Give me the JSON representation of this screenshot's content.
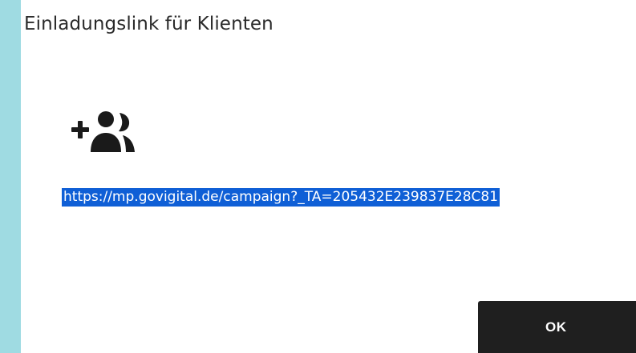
{
  "dialog": {
    "title": "Einladungslink für Klienten",
    "icon": "user-plus-group-icon",
    "invite_link": "https://mp.govigital.de/campaign?_TA=205432E239837E28C81",
    "ok_label": "OK"
  },
  "colors": {
    "backdrop": "#9fdbe2",
    "dialog_bg": "#ffffff",
    "link_highlight": "#0f5fd6",
    "button_bg": "#1f1f1f",
    "icon_color": "#1a1a1a"
  }
}
